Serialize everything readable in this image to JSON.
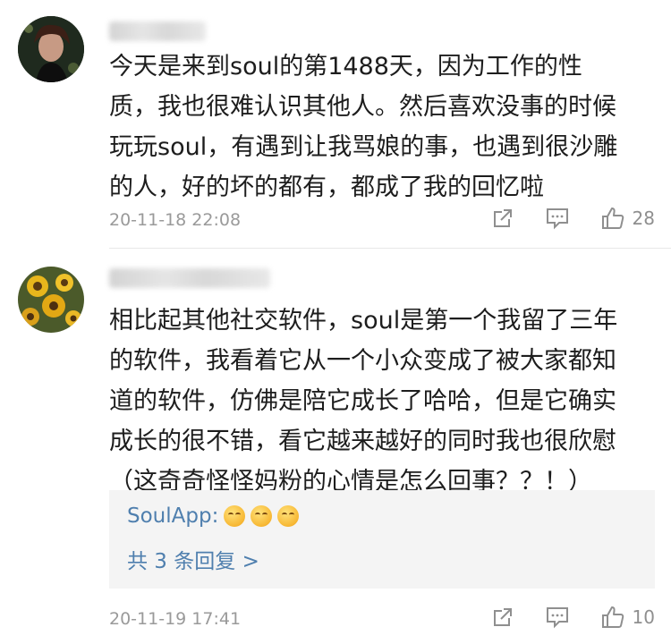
{
  "comments": [
    {
      "text_lines": [
        "今天是来到soul的第1488天，因为工作的性",
        "质，我也很难认识其他人。然后喜欢没事的时候",
        "玩玩soul，有遇到让我骂娘的事，也遇到很沙雕",
        "的人，好的坏的都有，都成了我的回忆啦"
      ],
      "time": "20-11-18 22:08",
      "likes": "28",
      "share_icon": "share-icon",
      "reply_icon": "comment-icon",
      "like_icon": "thumbs-up-icon"
    },
    {
      "text_lines": [
        "相比起其他社交软件，soul是第一个我留了三年",
        "的软件，我看着它从一个小众变成了被大家都知",
        "道的软件，仿佛是陪它成长了哈哈，但是它确实",
        "成长的很不错，看它越来越好的同时我也很欣慰",
        "（这奇奇怪怪妈粉的心情是怎么回事？？！）"
      ],
      "reply": {
        "user": "SoulApp:",
        "emoji_count": 3,
        "more": "共 3 条回复 >"
      },
      "time": "20-11-19 17:41",
      "likes": "10"
    }
  ],
  "colors": {
    "link": "#4f7fae",
    "meta": "#9a9a9a",
    "reply_bg": "#f4f4f4"
  }
}
